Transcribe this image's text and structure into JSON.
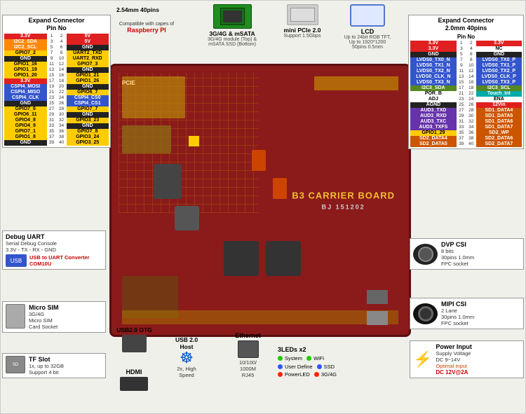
{
  "page": {
    "title": "B3 Carrier Board",
    "background": "#f0f0eb"
  },
  "left_panel": {
    "title": "Expand Connector\nPin No",
    "connector_type": "2.54mm 40pins",
    "pins": [
      {
        "left": "3.3V",
        "left_num": 1,
        "right_num": 2,
        "right": "5V",
        "left_color": "red",
        "right_color": "red"
      },
      {
        "left": "I2C2_SDA",
        "left_num": 3,
        "right_num": 4,
        "right": "5V",
        "left_color": "orange",
        "right_color": "red"
      },
      {
        "left": "I2C2_SCL",
        "left_num": 5,
        "right_num": 6,
        "right": "GND",
        "left_color": "orange",
        "right_color": "black"
      },
      {
        "left": "GPIO7_2",
        "left_num": 7,
        "right_num": 8,
        "right": "UART2_TXD",
        "left_color": "yellow",
        "right_color": "yellow"
      },
      {
        "left": "GND",
        "left_num": 9,
        "right_num": 10,
        "right": "UART2_RXD",
        "left_color": "black",
        "right_color": "yellow"
      },
      {
        "left": "GPIO1_16",
        "left_num": 11,
        "right_num": 12,
        "right": "GPIO7_3",
        "left_color": "yellow",
        "right_color": "yellow"
      },
      {
        "left": "GPIO1_19",
        "left_num": 13,
        "right_num": 14,
        "right": "GND",
        "left_color": "yellow",
        "right_color": "black"
      },
      {
        "left": "GPIO1_20",
        "left_num": 15,
        "right_num": 16,
        "right": "GPIO1_21",
        "left_color": "yellow",
        "right_color": "yellow"
      },
      {
        "left": "3.3V",
        "left_num": 17,
        "right_num": 18,
        "right": "GPIO1_26",
        "left_color": "red",
        "right_color": "yellow"
      },
      {
        "left": "CSPI4_MOSI",
        "left_num": 19,
        "right_num": 20,
        "right": "GND",
        "left_color": "blue",
        "right_color": "black"
      },
      {
        "left": "CSPI4_MISO",
        "left_num": 21,
        "right_num": 22,
        "right": "GPIO6_7",
        "left_color": "blue",
        "right_color": "yellow"
      },
      {
        "left": "CSPI4_CLK",
        "left_num": 23,
        "right_num": 24,
        "right": "CSPI4_CS0",
        "left_color": "blue",
        "right_color": "blue"
      },
      {
        "left": "GND",
        "left_num": 25,
        "right_num": 26,
        "right": "CSPI4_CS1",
        "left_color": "black",
        "right_color": "blue"
      },
      {
        "left": "GPIO7_6",
        "left_num": 27,
        "right_num": 28,
        "right": "GPIO7_7",
        "left_color": "yellow",
        "right_color": "yellow"
      },
      {
        "left": "GPIO6_11",
        "left_num": 29,
        "right_num": 30,
        "right": "GND",
        "left_color": "yellow",
        "right_color": "black"
      },
      {
        "left": "GPIO4_8",
        "left_num": 31,
        "right_num": 32,
        "right": "GPIO3_23",
        "left_color": "yellow",
        "right_color": "yellow"
      },
      {
        "left": "GPIO4_9",
        "left_num": 33,
        "right_num": 34,
        "right": "GND",
        "left_color": "yellow",
        "right_color": "black"
      },
      {
        "left": "GPIO7_1",
        "left_num": 35,
        "right_num": 36,
        "right": "GPIO7_8",
        "left_color": "yellow",
        "right_color": "yellow"
      },
      {
        "left": "GPIO1_8",
        "left_num": 37,
        "right_num": 38,
        "right": "GPIO3_24",
        "left_color": "yellow",
        "right_color": "yellow"
      },
      {
        "left": "GND",
        "left_num": 39,
        "right_num": 40,
        "right": "GPIO3_25",
        "left_color": "black",
        "right_color": "yellow"
      }
    ]
  },
  "right_panel": {
    "title": "Expand Connector\n2.0mm 40pins",
    "pin_title": "Pin No",
    "pins": [
      {
        "left": "3.3V",
        "left_num": 1,
        "right_num": 2,
        "right": "3.3V",
        "lc": "red",
        "rc": "red"
      },
      {
        "left": "3.3V",
        "left_num": 3,
        "right_num": 4,
        "right": "NC",
        "lc": "red",
        "rc": ""
      },
      {
        "left": "GND",
        "left_num": 5,
        "right_num": 6,
        "right": "GND",
        "lc": "black",
        "rc": "black"
      },
      {
        "left": "LVDS0_TX0_N",
        "left_num": 7,
        "right_num": 8,
        "right": "LVDS0_TX0_P",
        "lc": "lvds",
        "rc": "lvds"
      },
      {
        "left": "LVDS0_TX1_N",
        "left_num": 9,
        "right_num": 10,
        "right": "LVDS0_TX1_P",
        "lc": "lvds",
        "rc": "lvds"
      },
      {
        "left": "LVDS0_TX2_N",
        "left_num": 11,
        "right_num": 12,
        "right": "LVDS0_TX2_P",
        "lc": "lvds",
        "rc": "lvds"
      },
      {
        "left": "LVDS0_CLK_N",
        "left_num": 13,
        "right_num": 14,
        "right": "LVDS0_CLK_P",
        "lc": "lvds",
        "rc": "lvds"
      },
      {
        "left": "LVDS0_TX3_N",
        "left_num": 15,
        "right_num": 16,
        "right": "LVDS0_TX3_P",
        "lc": "lvds",
        "rc": "lvds"
      },
      {
        "left": "I2C3_SDА",
        "left_num": 17,
        "right_num": 18,
        "right": "I2C3_SCL",
        "lc": "i2c3",
        "rc": "i2c3"
      },
      {
        "left": "POR_B",
        "left_num": 21,
        "right_num": 22,
        "right": "Touch_Int",
        "lc": "",
        "rc": "touch"
      },
      {
        "left": "ADJ",
        "left_num": 23,
        "right_num": 24,
        "right": "ENA",
        "lc": "",
        "rc": ""
      },
      {
        "left": "AGND",
        "left_num": 25,
        "right_num": 26,
        "right": "12Vin",
        "lc": "black",
        "rc": "red"
      },
      {
        "left": "AUD3_TXD",
        "left_num": 27,
        "right_num": 28,
        "right": "SD1_DATA4",
        "lc": "aud",
        "rc": "sd"
      },
      {
        "left": "AUD3_RXD",
        "left_num": 29,
        "right_num": 30,
        "right": "SD1_DATA5",
        "lc": "aud",
        "rc": "sd"
      },
      {
        "left": "AUD3_TXC",
        "left_num": 31,
        "right_num": 32,
        "right": "SD1_DATA6",
        "lc": "aud",
        "rc": "sd"
      },
      {
        "left": "AUD3_TXFS",
        "left_num": 33,
        "right_num": 34,
        "right": "SD1_DATA7",
        "lc": "aud",
        "rc": "sd"
      },
      {
        "left": "GPIO1_29",
        "left_num": 35,
        "right_num": 36,
        "right": "SD2_WP",
        "lc": "yellow",
        "rc": "sd"
      },
      {
        "left": "SD2_DATA4",
        "left_num": 37,
        "right_num": 38,
        "right": "SD2_DATA6",
        "lc": "sd",
        "rc": "sd"
      },
      {
        "left": "SD2_DATA5",
        "left_num": 39,
        "right_num": 40,
        "right": "SD2_DATA7",
        "lc": "sd",
        "rc": "sd"
      }
    ]
  },
  "top_modules": {
    "connector_2_54": {
      "label": "2.54mm 40pins"
    },
    "module_3g4g": {
      "title": "3G/4G & mSATA",
      "desc": "3G/4G module (Top) &\nmSATA SSD (Bottom)",
      "icon": "chip"
    },
    "mini_pcie": {
      "title": "mini PCIe 2.0",
      "desc": "Support 1.5Gbps",
      "icon": "card"
    },
    "lcd": {
      "title": "LCD",
      "desc": "Up to 24bit RGB TFT,\nUp to 1920*1200\n50pins 0.5mm",
      "icon": "screen"
    },
    "rpi_compat": {
      "text": "Compatible with capes of",
      "brand": "Raspberry PI"
    }
  },
  "bottom_modules": {
    "debug_uart": {
      "title": "Debug UART",
      "desc": "Serial Debug Console\n3.3V - TX - RX - GND",
      "link": "USB to UART Converter\nCOM10U"
    },
    "micro_sim": {
      "title": "Micro SIM",
      "desc": "3G/4G\nMicro SIM\nCard Socket"
    },
    "tf_slot": {
      "title": "TF Slot",
      "desc": "1x, up to 32GB\nSupport 4 bit"
    },
    "hdmi": {
      "title": "HDMI"
    },
    "usb_otg": {
      "title": "USB2.0 OTG"
    },
    "usb_host": {
      "title": "USB 2.0\nHost",
      "desc": "2x, High\nSpeed"
    },
    "ethernet": {
      "title": "Ethernet",
      "desc": "10/100/\n1000M\nRJ45"
    },
    "leds": {
      "title": "3LEDs x2",
      "items": [
        {
          "label": "System",
          "color": "green",
          "name": "WiFi"
        },
        {
          "label": "User Define",
          "color": "blue",
          "name": "SSD"
        },
        {
          "label": "PowerLED",
          "color": "red",
          "name": "3G/4G"
        }
      ]
    },
    "dvp_csi": {
      "title": "DVP CSI",
      "desc": "8 bits\n30pins 1.0mm\nFPC socket"
    },
    "mipi_csi": {
      "title": "MIPI CSI",
      "desc": "2 Lane\n30pins 1.0mm\nFPC socket"
    },
    "power_input": {
      "title": "Power Input",
      "desc": "Supply Voltage\nDC 9~14V",
      "optimal": "Optimal Input",
      "optimal_value": "DC 12V@2A"
    }
  },
  "board": {
    "label": "B3 CARRIER BOARD",
    "id": "BJ 151202"
  }
}
